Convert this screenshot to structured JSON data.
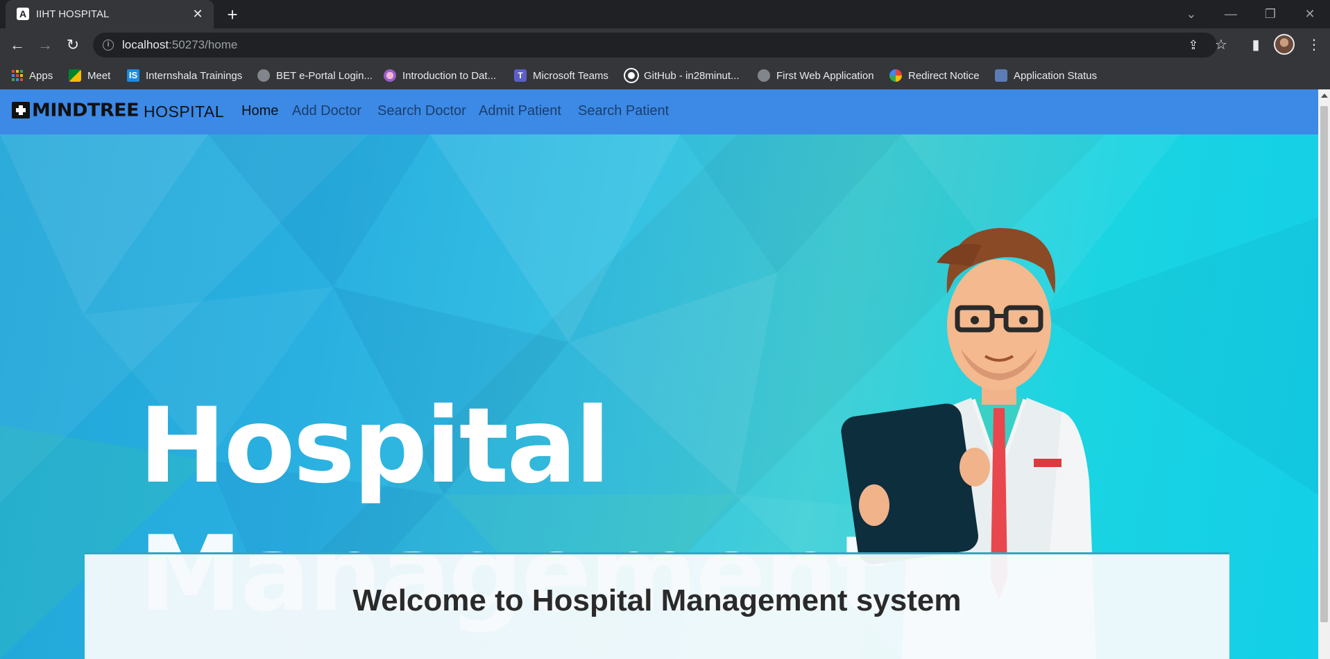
{
  "browser": {
    "tab": {
      "favicon_letter": "A",
      "title": "IIHT HOSPITAL"
    },
    "url": {
      "host": "localhost",
      "path": ":50273/home"
    },
    "bookmarks": [
      {
        "label": "Apps",
        "icon": "apps-grid-icon"
      },
      {
        "label": "Meet",
        "icon": "meet-icon"
      },
      {
        "label": "Internshala Trainings",
        "icon": "internshala-icon"
      },
      {
        "label": "BET e-Portal Login...",
        "icon": "globe-icon"
      },
      {
        "label": "Introduction to Dat...",
        "icon": "course-icon"
      },
      {
        "label": "Microsoft Teams",
        "icon": "teams-icon"
      },
      {
        "label": "GitHub - in28minut...",
        "icon": "github-icon"
      },
      {
        "label": "First Web Application",
        "icon": "globe-icon"
      },
      {
        "label": "Redirect Notice",
        "icon": "google-icon"
      },
      {
        "label": "Application Status",
        "icon": "app-status-icon"
      }
    ]
  },
  "navbar": {
    "logo_text": "MINDTREE",
    "brand": "HOSPITAL",
    "links": [
      {
        "label": "Home",
        "active": true
      },
      {
        "label": "Add Doctor",
        "active": false
      },
      {
        "label": "Search Doctor",
        "active": false
      },
      {
        "label": "Admit Patient",
        "active": false
      },
      {
        "label": "Search Patient",
        "active": false
      }
    ]
  },
  "hero": {
    "line1": "Hospital",
    "line2": "Management"
  },
  "welcome": {
    "title": "Welcome to Hospital Management system"
  },
  "colors": {
    "navbar": "#3c89e6",
    "hero_bg": "#1ec6de"
  }
}
